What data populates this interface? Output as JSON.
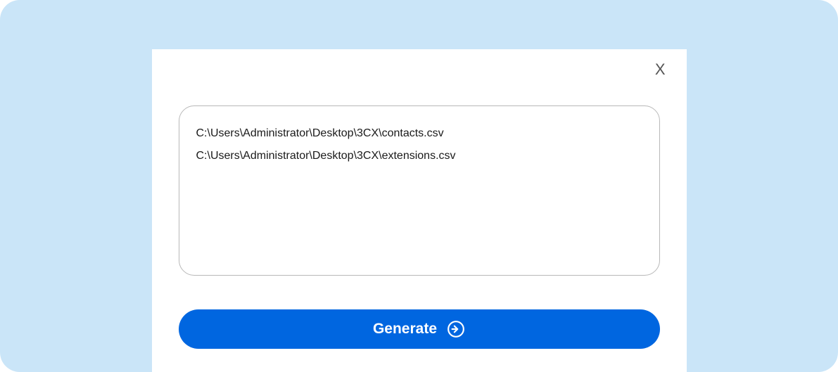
{
  "dialog": {
    "close_label": "X",
    "files": [
      "C:\\Users\\Administrator\\Desktop\\3CX\\contacts.csv",
      "C:\\Users\\Administrator\\Desktop\\3CX\\extensions.csv"
    ],
    "generate_label": "Generate"
  },
  "colors": {
    "background": "#cae5f8",
    "primary": "#0066e0"
  }
}
